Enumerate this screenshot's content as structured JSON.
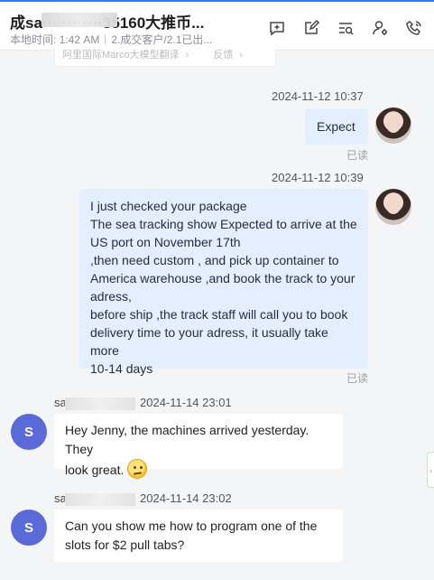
{
  "header": {
    "title": "成sa··· ········35160大推币...",
    "local_time": "本地时间: 1:42 AM",
    "status": "2.成交客户/2.1已出...",
    "icons": [
      "add-comment-icon",
      "edit-icon",
      "search-list-icon",
      "contact-settings-icon",
      "phone-settings-icon"
    ]
  },
  "translate_strip": {
    "service": "阿里国际Marco大模型翻译",
    "feedback": "反馈"
  },
  "messages": [
    {
      "direction": "outgoing",
      "timestamp": "2024-11-12 10:37",
      "lines": [
        "Expect"
      ],
      "read_label": "已读"
    },
    {
      "direction": "outgoing",
      "timestamp": "2024-11-12 10:39",
      "lines": [
        "I just checked your package",
        "The sea tracking show Expected to arrive at the",
        "US port on November 17th",
        ",then need custom , and pick up container to",
        "America warehouse ,and book the track to your",
        "adress,",
        "before ship ,the track staff will call you to book",
        "delivery time to your adress, it usually take more",
        "10-14 days"
      ],
      "read_label": "已读"
    },
    {
      "direction": "incoming",
      "sender": "sa",
      "avatar_letter": "S",
      "timestamp": "2024-11-14 23:01",
      "lines": [
        "Hey Jenny, the machines arrived yesterday. They",
        "look great."
      ]
    },
    {
      "direction": "incoming",
      "sender": "sa",
      "avatar_letter": "S",
      "timestamp": "2024-11-14 23:02",
      "lines": [
        "Can you show me how to program one of the",
        "slots for $2 pull tabs?"
      ]
    }
  ],
  "side_tab": "›",
  "colors": {
    "accent": "#2f7cf6",
    "outgoing_bubble": "#e3efff",
    "incoming_bubble": "#ffffff",
    "avatar_s": "#5b6ad9",
    "background": "#f4f5f7"
  }
}
